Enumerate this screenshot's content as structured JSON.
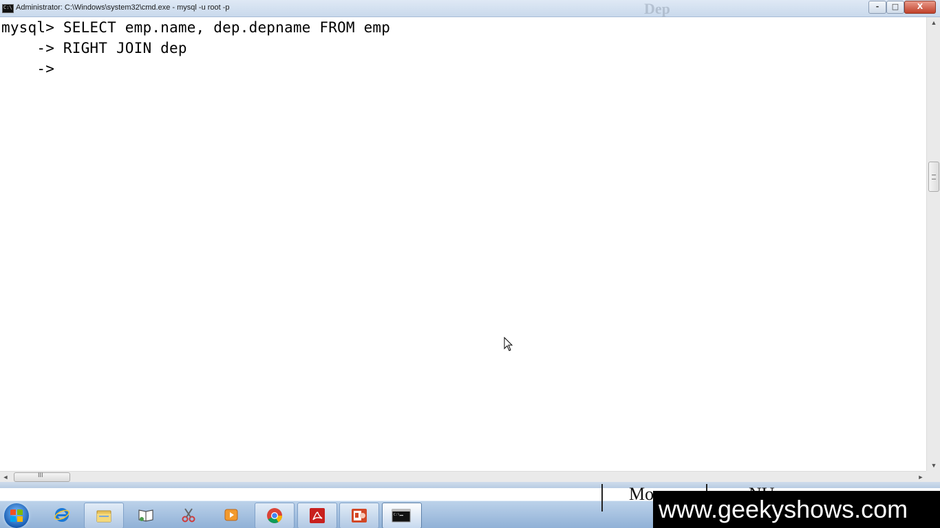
{
  "window": {
    "title": "Administrator: C:\\Windows\\system32\\cmd.exe - mysql  -u root -p",
    "background_ghost_text": "Dep",
    "controls": {
      "minimize": "-",
      "maximize": "□",
      "close": "X"
    }
  },
  "console": {
    "lines": [
      "mysql> SELECT emp.name, dep.depname FROM emp",
      "    -> RIGHT JOIN dep",
      "    ->"
    ]
  },
  "scrollbars": {
    "vertical_grip": "≡",
    "horizontal_grip": "III",
    "arrow_up": "▲",
    "arrow_down": "▼",
    "arrow_left": "◄",
    "arrow_right": "►"
  },
  "background_window": {
    "cells": [
      "Mo",
      "NU"
    ]
  },
  "taskbar": {
    "items": [
      {
        "name": "start-button",
        "icon": "windows-logo-icon"
      },
      {
        "name": "internet-explorer",
        "icon": "internet-explorer-icon"
      },
      {
        "name": "windows-explorer",
        "icon": "folder-icon"
      },
      {
        "name": "reader-app",
        "icon": "book-icon"
      },
      {
        "name": "snipping-tool",
        "icon": "scissors-icon"
      },
      {
        "name": "media-player",
        "icon": "media-player-icon"
      },
      {
        "name": "google-chrome",
        "icon": "chrome-icon"
      },
      {
        "name": "adobe-reader",
        "icon": "acrobat-icon"
      },
      {
        "name": "powerpoint",
        "icon": "powerpoint-icon"
      },
      {
        "name": "command-prompt",
        "icon": "cmd-icon"
      }
    ]
  },
  "watermark": {
    "text": "www.geekyshows.com"
  },
  "colors": {
    "terminal_bg": "#ffffff",
    "terminal_text": "#000000",
    "taskbar": "#9bb8dc",
    "close_button": "#c8503a"
  }
}
